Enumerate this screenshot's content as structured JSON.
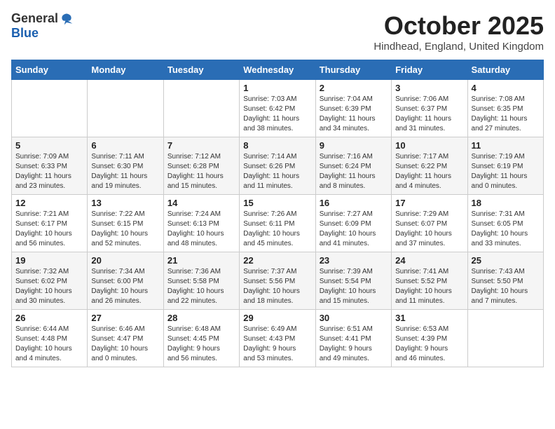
{
  "logo": {
    "general": "General",
    "blue": "Blue"
  },
  "title": "October 2025",
  "location": "Hindhead, England, United Kingdom",
  "days_of_week": [
    "Sunday",
    "Monday",
    "Tuesday",
    "Wednesday",
    "Thursday",
    "Friday",
    "Saturday"
  ],
  "weeks": [
    [
      {
        "day": "",
        "info": ""
      },
      {
        "day": "",
        "info": ""
      },
      {
        "day": "",
        "info": ""
      },
      {
        "day": "1",
        "info": "Sunrise: 7:03 AM\nSunset: 6:42 PM\nDaylight: 11 hours\nand 38 minutes."
      },
      {
        "day": "2",
        "info": "Sunrise: 7:04 AM\nSunset: 6:39 PM\nDaylight: 11 hours\nand 34 minutes."
      },
      {
        "day": "3",
        "info": "Sunrise: 7:06 AM\nSunset: 6:37 PM\nDaylight: 11 hours\nand 31 minutes."
      },
      {
        "day": "4",
        "info": "Sunrise: 7:08 AM\nSunset: 6:35 PM\nDaylight: 11 hours\nand 27 minutes."
      }
    ],
    [
      {
        "day": "5",
        "info": "Sunrise: 7:09 AM\nSunset: 6:33 PM\nDaylight: 11 hours\nand 23 minutes."
      },
      {
        "day": "6",
        "info": "Sunrise: 7:11 AM\nSunset: 6:30 PM\nDaylight: 11 hours\nand 19 minutes."
      },
      {
        "day": "7",
        "info": "Sunrise: 7:12 AM\nSunset: 6:28 PM\nDaylight: 11 hours\nand 15 minutes."
      },
      {
        "day": "8",
        "info": "Sunrise: 7:14 AM\nSunset: 6:26 PM\nDaylight: 11 hours\nand 11 minutes."
      },
      {
        "day": "9",
        "info": "Sunrise: 7:16 AM\nSunset: 6:24 PM\nDaylight: 11 hours\nand 8 minutes."
      },
      {
        "day": "10",
        "info": "Sunrise: 7:17 AM\nSunset: 6:22 PM\nDaylight: 11 hours\nand 4 minutes."
      },
      {
        "day": "11",
        "info": "Sunrise: 7:19 AM\nSunset: 6:19 PM\nDaylight: 11 hours\nand 0 minutes."
      }
    ],
    [
      {
        "day": "12",
        "info": "Sunrise: 7:21 AM\nSunset: 6:17 PM\nDaylight: 10 hours\nand 56 minutes."
      },
      {
        "day": "13",
        "info": "Sunrise: 7:22 AM\nSunset: 6:15 PM\nDaylight: 10 hours\nand 52 minutes."
      },
      {
        "day": "14",
        "info": "Sunrise: 7:24 AM\nSunset: 6:13 PM\nDaylight: 10 hours\nand 48 minutes."
      },
      {
        "day": "15",
        "info": "Sunrise: 7:26 AM\nSunset: 6:11 PM\nDaylight: 10 hours\nand 45 minutes."
      },
      {
        "day": "16",
        "info": "Sunrise: 7:27 AM\nSunset: 6:09 PM\nDaylight: 10 hours\nand 41 minutes."
      },
      {
        "day": "17",
        "info": "Sunrise: 7:29 AM\nSunset: 6:07 PM\nDaylight: 10 hours\nand 37 minutes."
      },
      {
        "day": "18",
        "info": "Sunrise: 7:31 AM\nSunset: 6:05 PM\nDaylight: 10 hours\nand 33 minutes."
      }
    ],
    [
      {
        "day": "19",
        "info": "Sunrise: 7:32 AM\nSunset: 6:02 PM\nDaylight: 10 hours\nand 30 minutes."
      },
      {
        "day": "20",
        "info": "Sunrise: 7:34 AM\nSunset: 6:00 PM\nDaylight: 10 hours\nand 26 minutes."
      },
      {
        "day": "21",
        "info": "Sunrise: 7:36 AM\nSunset: 5:58 PM\nDaylight: 10 hours\nand 22 minutes."
      },
      {
        "day": "22",
        "info": "Sunrise: 7:37 AM\nSunset: 5:56 PM\nDaylight: 10 hours\nand 18 minutes."
      },
      {
        "day": "23",
        "info": "Sunrise: 7:39 AM\nSunset: 5:54 PM\nDaylight: 10 hours\nand 15 minutes."
      },
      {
        "day": "24",
        "info": "Sunrise: 7:41 AM\nSunset: 5:52 PM\nDaylight: 10 hours\nand 11 minutes."
      },
      {
        "day": "25",
        "info": "Sunrise: 7:43 AM\nSunset: 5:50 PM\nDaylight: 10 hours\nand 7 minutes."
      }
    ],
    [
      {
        "day": "26",
        "info": "Sunrise: 6:44 AM\nSunset: 4:48 PM\nDaylight: 10 hours\nand 4 minutes."
      },
      {
        "day": "27",
        "info": "Sunrise: 6:46 AM\nSunset: 4:47 PM\nDaylight: 10 hours\nand 0 minutes."
      },
      {
        "day": "28",
        "info": "Sunrise: 6:48 AM\nSunset: 4:45 PM\nDaylight: 9 hours\nand 56 minutes."
      },
      {
        "day": "29",
        "info": "Sunrise: 6:49 AM\nSunset: 4:43 PM\nDaylight: 9 hours\nand 53 minutes."
      },
      {
        "day": "30",
        "info": "Sunrise: 6:51 AM\nSunset: 4:41 PM\nDaylight: 9 hours\nand 49 minutes."
      },
      {
        "day": "31",
        "info": "Sunrise: 6:53 AM\nSunset: 4:39 PM\nDaylight: 9 hours\nand 46 minutes."
      },
      {
        "day": "",
        "info": ""
      }
    ]
  ]
}
